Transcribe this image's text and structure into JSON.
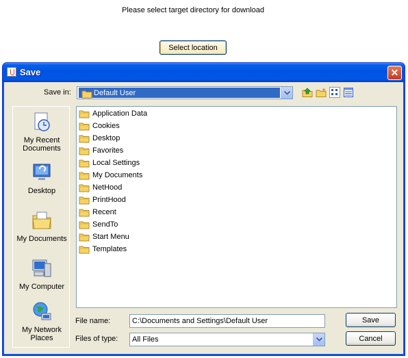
{
  "page": {
    "prompt": "Please select target directory for download",
    "select_button": "Select location"
  },
  "dialog": {
    "title": "Save",
    "close_glyph": "✕",
    "save_in_label": "Save in:",
    "save_in_value": "Default User",
    "places": [
      {
        "label": "My Recent Documents",
        "icon": "recent-documents-icon"
      },
      {
        "label": "Desktop",
        "icon": "desktop-icon"
      },
      {
        "label": "My Documents",
        "icon": "my-documents-icon"
      },
      {
        "label": "My Computer",
        "icon": "my-computer-icon"
      },
      {
        "label": "My Network Places",
        "icon": "network-places-icon"
      }
    ],
    "folders": [
      "Application Data",
      "Cookies",
      "Desktop",
      "Favorites",
      "Local Settings",
      "My Documents",
      "NetHood",
      "PrintHood",
      "Recent",
      "SendTo",
      "Start Menu",
      "Templates"
    ],
    "file_name_label": "File name:",
    "file_name_value": "C:\\Documents and Settings\\Default User",
    "files_of_type_label": "Files of type:",
    "files_of_type_value": "All Files",
    "save_button": "Save",
    "cancel_button": "Cancel"
  },
  "colors": {
    "title_bar": "#0054e3",
    "dialog_bg": "#ece9d8",
    "selection": "#316ac5",
    "folder_yellow": "#f6d365"
  }
}
